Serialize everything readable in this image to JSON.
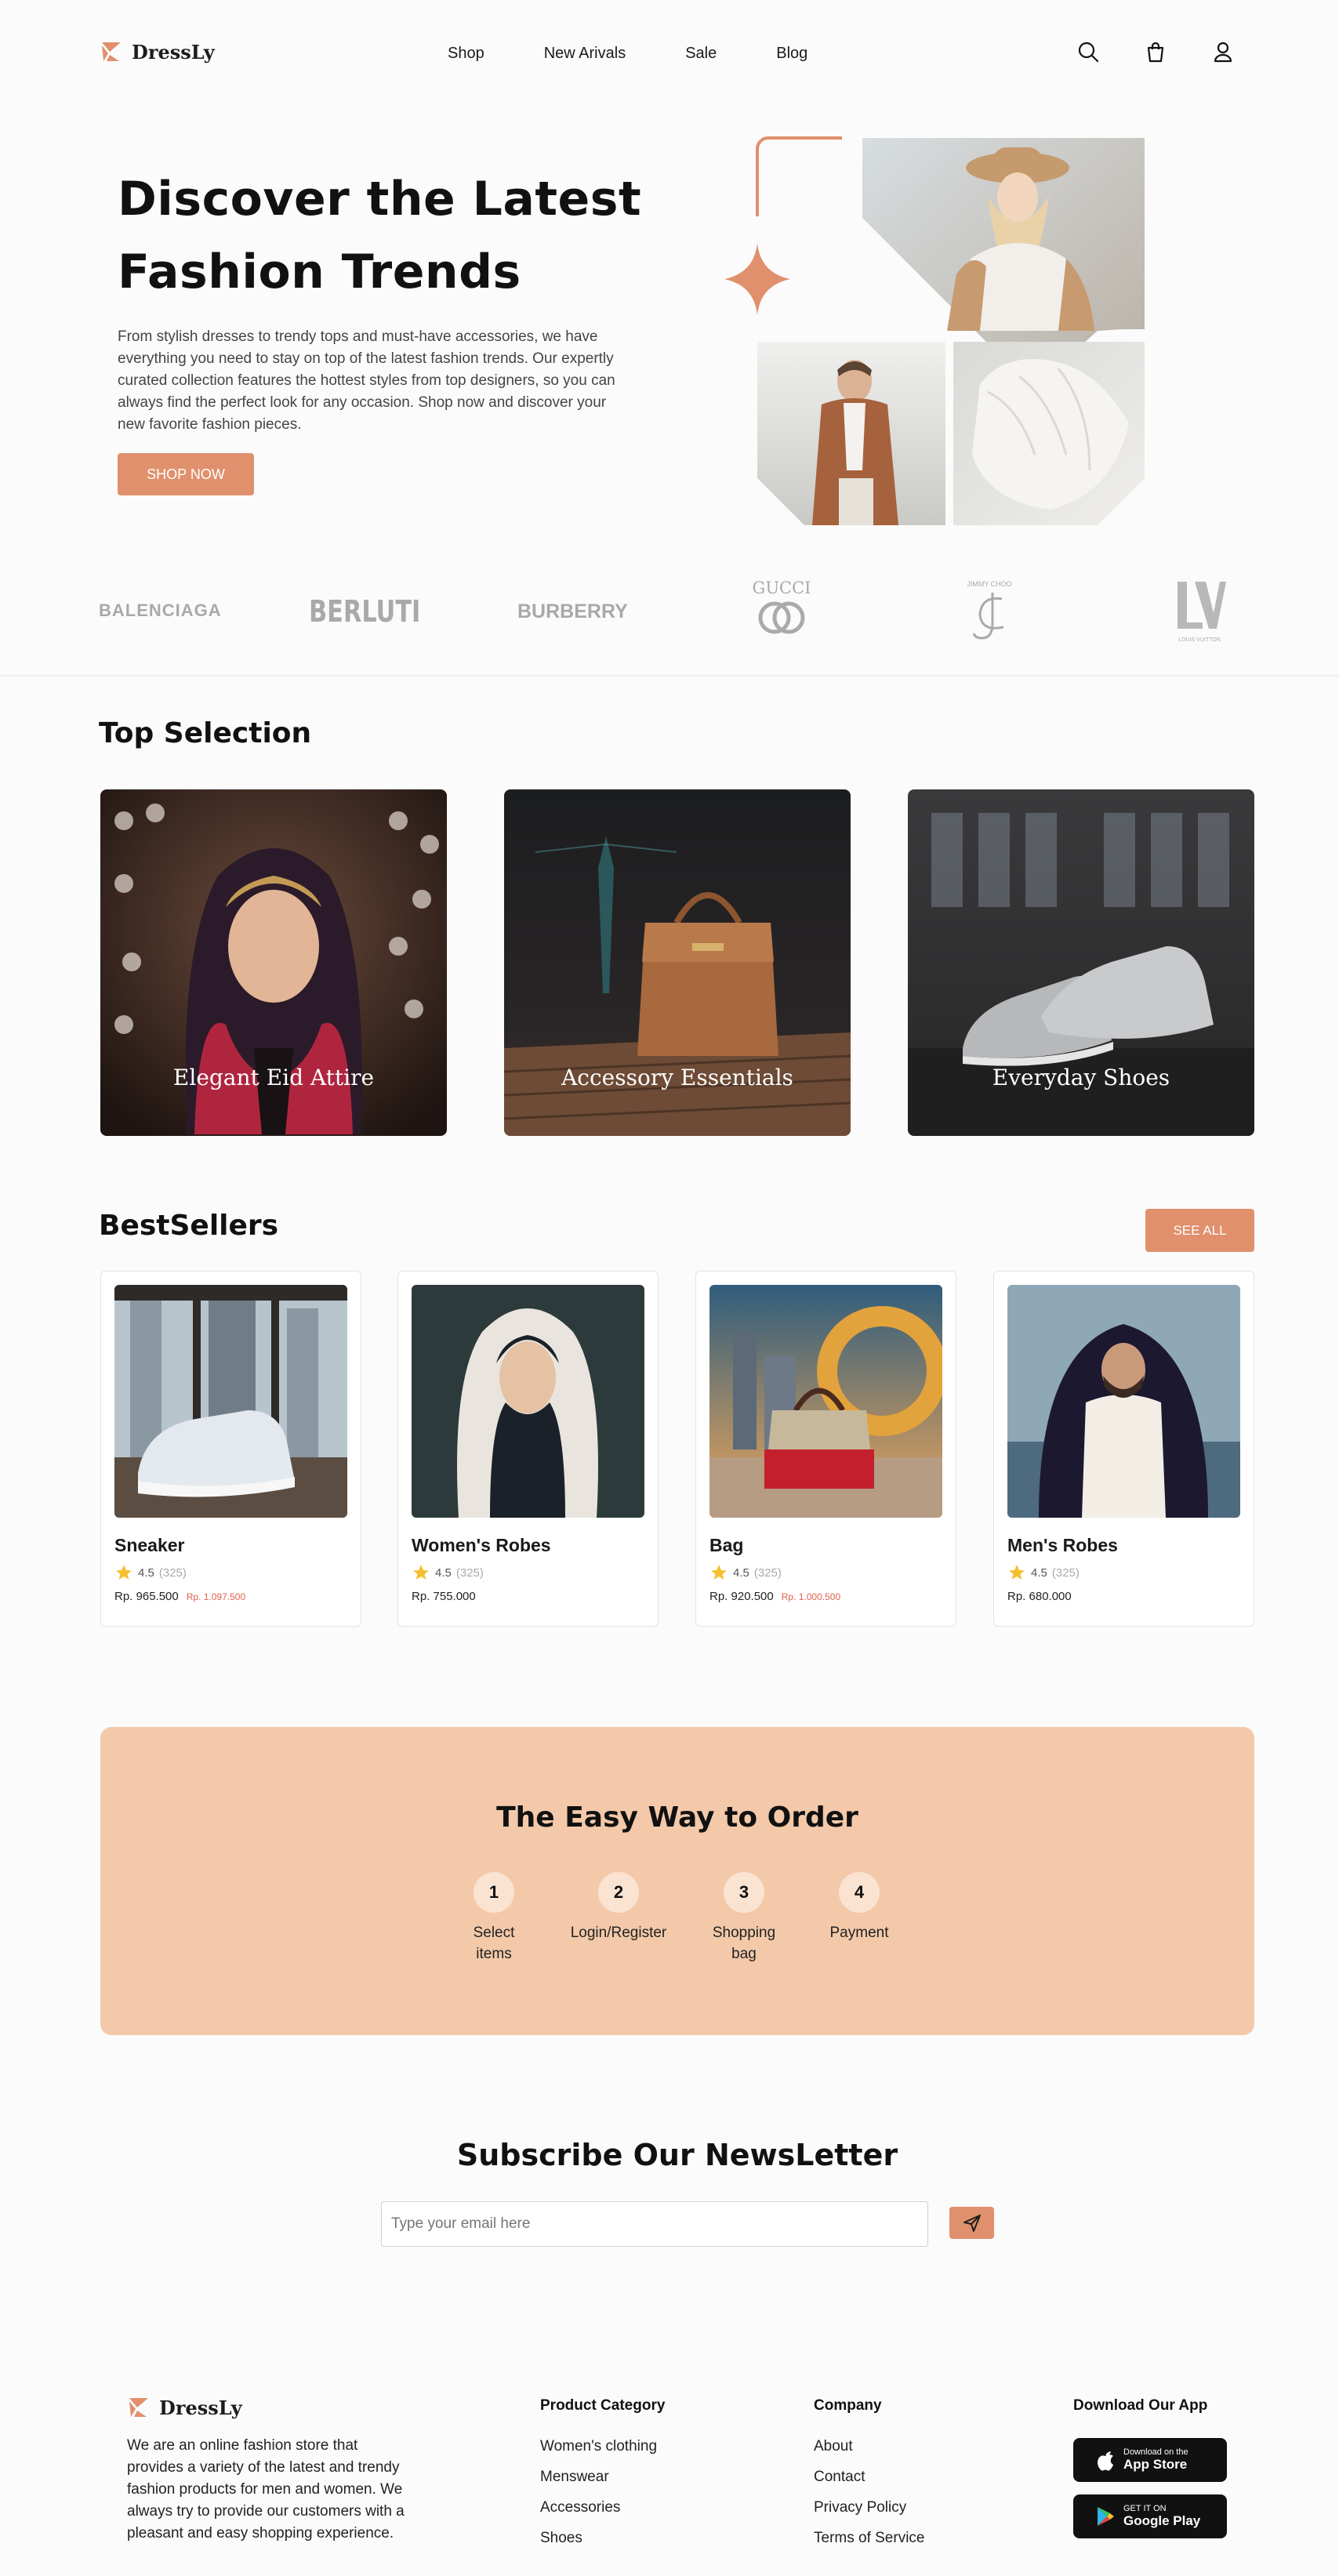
{
  "header": {
    "brand": "DressLy",
    "nav": [
      "Shop",
      "New Arivals",
      "Sale",
      "Blog"
    ]
  },
  "hero": {
    "title_line1": "Discover the Latest",
    "title_line2": "Fashion Trends",
    "description": "From stylish dresses to trendy tops and must-have accessories, we have everything you need to stay on top of the latest fashion trends. Our expertly curated collection features the hottest styles from top designers, so you can always find the perfect look for any occasion. Shop now and discover your new favorite fashion pieces.",
    "cta": "SHOP NOW"
  },
  "brands": [
    "BALENCIAGA",
    "BERLUTI",
    "BURBERRY",
    "GUCCI",
    "JIMMY CHOO",
    "LOUIS VUITTON"
  ],
  "top_selection": {
    "title": "Top Selection",
    "items": [
      "Elegant Eid Attire",
      "Accessory Essentials",
      "Everyday Shoes"
    ]
  },
  "bestsellers": {
    "title": "BestSellers",
    "see_all": "SEE ALL",
    "products": [
      {
        "name": "Sneaker",
        "rating": "4.5",
        "reviews": "(325)",
        "price": "Rp. 965.500",
        "old_price": "Rp. 1.097.500"
      },
      {
        "name": "Women's Robes",
        "rating": "4.5",
        "reviews": "(325)",
        "price": "Rp. 755.000",
        "old_price": ""
      },
      {
        "name": "Bag",
        "rating": "4.5",
        "reviews": "(325)",
        "price": "Rp. 920.500",
        "old_price": "Rp. 1.000.500"
      },
      {
        "name": "Men's Robes",
        "rating": "4.5",
        "reviews": "(325)",
        "price": "Rp. 680.000",
        "old_price": ""
      }
    ]
  },
  "order": {
    "title": "The Easy Way to Order",
    "steps": [
      {
        "num": "1",
        "line1": "Select",
        "line2": "items"
      },
      {
        "num": "2",
        "line1": "Login/Register",
        "line2": ""
      },
      {
        "num": "3",
        "line1": "Shopping",
        "line2": "bag"
      },
      {
        "num": "4",
        "line1": "Payment",
        "line2": ""
      }
    ]
  },
  "newsletter": {
    "title": "Subscribe Our NewsLetter",
    "placeholder": "Type your email here"
  },
  "footer": {
    "brand": "DressLy",
    "about": "We are an online fashion store that provides a variety of the latest and trendy fashion products for men and women. We always try to provide our customers with a pleasant and easy shopping experience.",
    "product_category": {
      "title": "Product Category",
      "links": [
        "Women's clothing",
        "Menswear",
        "Accessories",
        "Shoes"
      ]
    },
    "company": {
      "title": "Company",
      "links": [
        "About",
        "Contact",
        "Privacy Policy",
        "Terms of Service"
      ]
    },
    "app": {
      "title": "Download Our App",
      "appstore_small": "Download on the",
      "appstore_big": "App Store",
      "googleplay_small": "GET IT ON",
      "googleplay_big": "Google Play"
    }
  },
  "colors": {
    "accent": "#e0906c",
    "order_bg": "#f3c9a9"
  }
}
